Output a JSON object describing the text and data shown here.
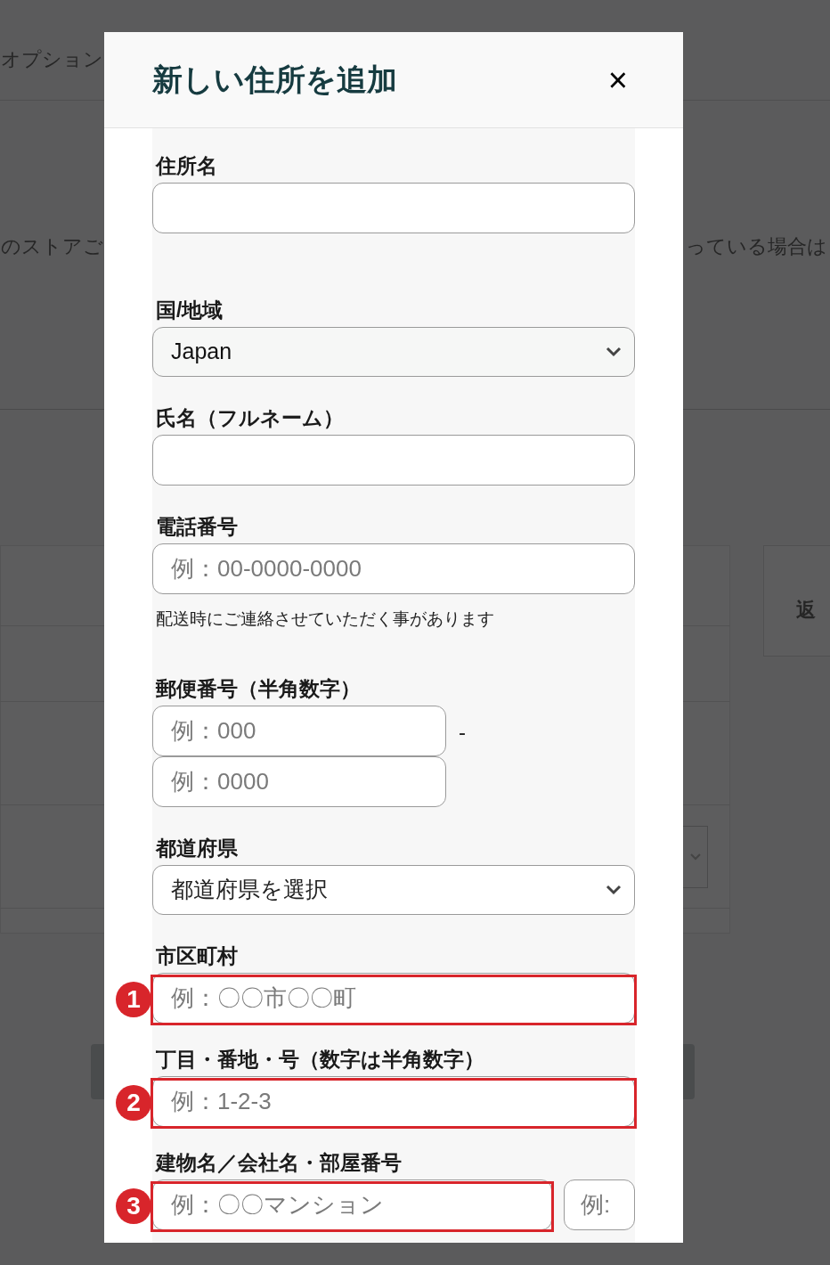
{
  "background_texts": [
    "オプション",
    "のストアご",
    "っている場合は",
    "返"
  ],
  "dialog": {
    "title": "新しい住所を追加",
    "close": "×"
  },
  "fields": [
    {
      "kind": "text",
      "label": "住所名"
    },
    {
      "kind": "select",
      "label": "国/地域",
      "value": "Japan",
      "filled": true
    },
    {
      "kind": "text",
      "label": "氏名（フルネーム）"
    },
    {
      "kind": "text",
      "label": "電話番号",
      "placeholder": "例：00-0000-0000",
      "note": "配送時にご連絡させていただく事があります"
    },
    {
      "kind": "postal",
      "label": "郵便番号（半角数字）",
      "placeholders": [
        "例：000",
        "例：0000"
      ],
      "separator": "-"
    },
    {
      "kind": "select",
      "label": "都道府県",
      "value": "都道府県を選択",
      "filled": false
    },
    {
      "kind": "text",
      "label": "市区町村",
      "placeholder": "例：〇〇市〇〇町",
      "annotation": "1"
    },
    {
      "kind": "text",
      "label": "丁目・番地・号（数字は半角数字）",
      "placeholder": "例：1-2-3",
      "annotation": "2"
    },
    {
      "kind": "pair",
      "label": "建物名／会社名・部屋番号",
      "placeholders": [
        "例：〇〇マンション",
        "例:"
      ],
      "annotation": "3"
    }
  ]
}
